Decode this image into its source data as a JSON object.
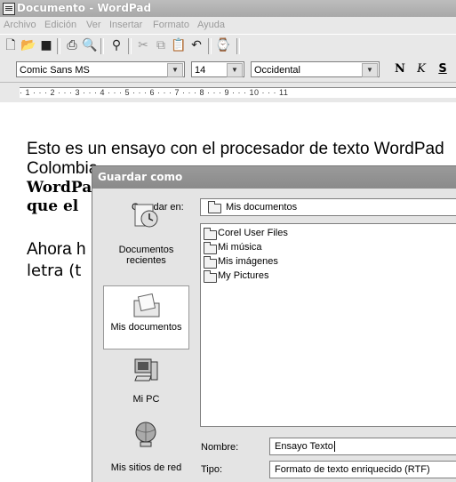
{
  "window": {
    "title": "Documento - WordPad"
  },
  "menu": [
    "Archivo",
    "Edición",
    "Ver",
    "Insertar",
    "Formato",
    "Ayuda"
  ],
  "toolbar": {
    "icons": [
      "new-icon",
      "open-icon",
      "save-icon",
      "print-icon",
      "print-preview-icon",
      "find-icon",
      "cut-icon",
      "copy-icon",
      "paste-icon",
      "undo-icon",
      "insert-datetime-icon"
    ]
  },
  "format_bar": {
    "font": "Comic Sans MS",
    "size": "14",
    "script": "Occidental",
    "bold": "N",
    "italic": "K",
    "underline": "S"
  },
  "ruler": {
    "text": "· 1 · · · 2 · · · 3 · · · 4 · · · 5 · · · 6 · · · 7 · · · 8 · · · 9 · · · 10 · · · 11"
  },
  "document": {
    "line1": "Esto es un ensayo con el procesador de texto WordPad",
    "line2": "Colombia",
    "line3": "WordPad",
    "line4": "que el",
    "line5": "Ahora h",
    "line6": "letra (t"
  },
  "dialog": {
    "title": "Guardar como",
    "look_in_label": "Guardar en:",
    "look_in_value": "Mis documentos",
    "places": [
      {
        "label": "Documentos recientes"
      },
      {
        "label": "Mis documentos"
      },
      {
        "label": "Mi PC"
      },
      {
        "label": "Mis sitios de red"
      }
    ],
    "files": [
      "Corel User Files",
      "Mi música",
      "Mis imágenes",
      "My Pictures"
    ],
    "name_label": "Nombre:",
    "name_value": "Ensayo Texto",
    "type_label": "Tipo:",
    "type_value": "Formato de texto enriquecido (RTF)"
  }
}
